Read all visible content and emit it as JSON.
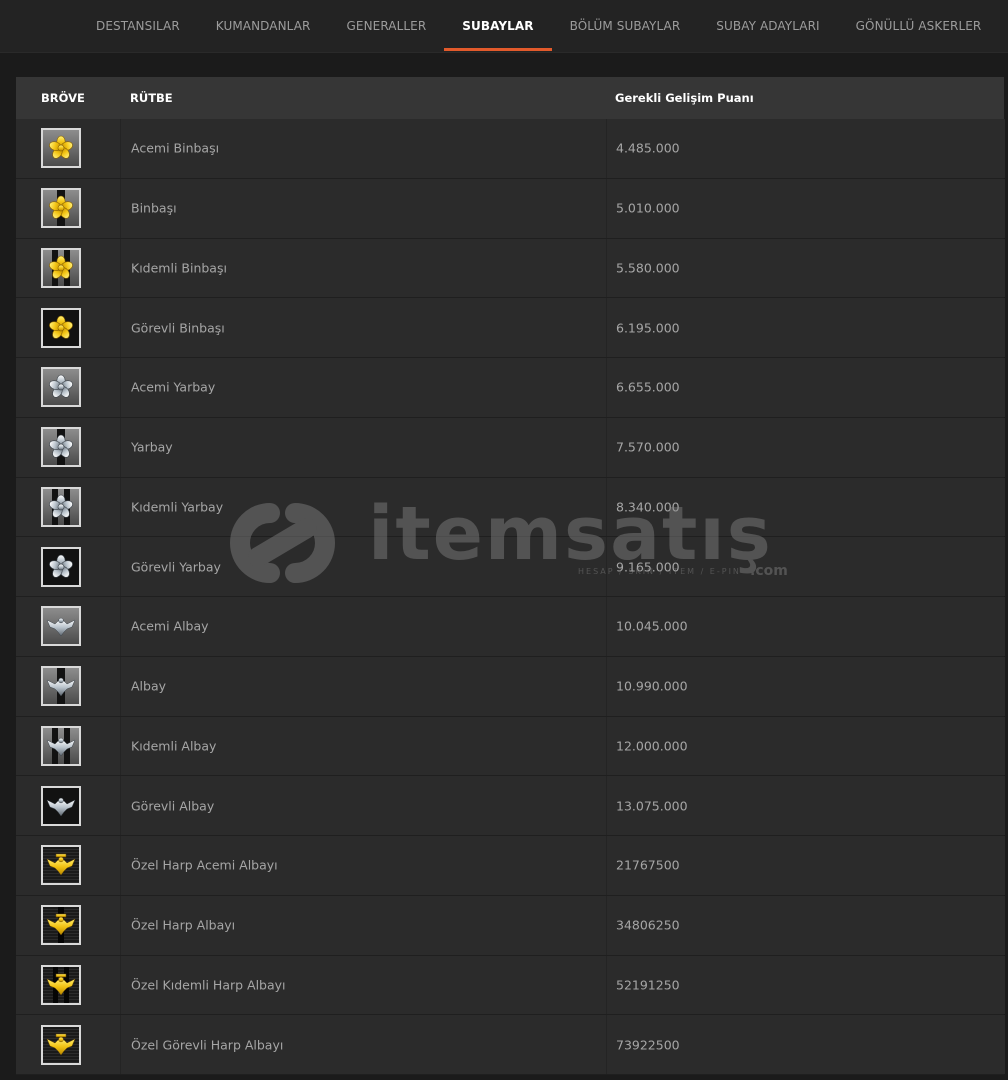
{
  "nav": {
    "tabs": [
      {
        "label": "DESTANSILAR",
        "active": false
      },
      {
        "label": "KUMANDANLAR",
        "active": false
      },
      {
        "label": "GENERALLER",
        "active": false
      },
      {
        "label": "SUBAYLAR",
        "active": true
      },
      {
        "label": "BÖLÜM SUBAYLAR",
        "active": false
      },
      {
        "label": "SUBAY ADAYLARI",
        "active": false
      },
      {
        "label": "GÖNÜLLÜ ASKERLER",
        "active": false
      }
    ],
    "accent_color": "#e25a2b"
  },
  "table": {
    "headers": {
      "badge": "BRÖVE",
      "rank": "RÜTBE",
      "points": "Gerekli Gelişim Puanı"
    },
    "rows": [
      {
        "rank": "Acemi Binbaşı",
        "points": "4.485.000",
        "badge_icon": "gold-leaf-icon",
        "stripes": 0,
        "tone": "gold"
      },
      {
        "rank": "Binbaşı",
        "points": "5.010.000",
        "badge_icon": "gold-leaf-icon",
        "stripes": 1,
        "tone": "gold"
      },
      {
        "rank": "Kıdemli Binbaşı",
        "points": "5.580.000",
        "badge_icon": "gold-leaf-icon",
        "stripes": 2,
        "tone": "gold"
      },
      {
        "rank": "Görevli Binbaşı",
        "points": "6.195.000",
        "badge_icon": "gold-leaf-icon",
        "stripes": 3,
        "tone": "gold"
      },
      {
        "rank": "Acemi Yarbay",
        "points": "6.655.000",
        "badge_icon": "silver-leaf-icon",
        "stripes": 0,
        "tone": "silver"
      },
      {
        "rank": "Yarbay",
        "points": "7.570.000",
        "badge_icon": "silver-leaf-icon",
        "stripes": 1,
        "tone": "silver"
      },
      {
        "rank": "Kıdemli Yarbay",
        "points": "8.340.000",
        "badge_icon": "silver-leaf-icon",
        "stripes": 2,
        "tone": "silver"
      },
      {
        "rank": "Görevli Yarbay",
        "points": "9.165.000",
        "badge_icon": "silver-leaf-icon",
        "stripes": 3,
        "tone": "silver"
      },
      {
        "rank": "Acemi Albay",
        "points": "10.045.000",
        "badge_icon": "silver-eagle-icon",
        "stripes": 0,
        "tone": "silver"
      },
      {
        "rank": "Albay",
        "points": "10.990.000",
        "badge_icon": "silver-eagle-icon",
        "stripes": 1,
        "tone": "silver"
      },
      {
        "rank": "Kıdemli Albay",
        "points": "12.000.000",
        "badge_icon": "silver-eagle-icon",
        "stripes": 2,
        "tone": "silver"
      },
      {
        "rank": "Görevli Albay",
        "points": "13.075.000",
        "badge_icon": "silver-eagle-icon",
        "stripes": 3,
        "tone": "silver"
      },
      {
        "rank": "Özel Harp Acemi Albayı",
        "points": "21767500",
        "badge_icon": "gold-eagle-icon",
        "stripes": 0,
        "tone": "black"
      },
      {
        "rank": "Özel Harp Albayı",
        "points": "34806250",
        "badge_icon": "gold-eagle-icon",
        "stripes": 1,
        "tone": "black"
      },
      {
        "rank": "Özel Kıdemli Harp Albayı",
        "points": "52191250",
        "badge_icon": "gold-eagle-icon",
        "stripes": 2,
        "tone": "black"
      },
      {
        "rank": "Özel Görevli Harp Albayı",
        "points": "73922500",
        "badge_icon": "gold-eagle-icon",
        "stripes": 3,
        "tone": "black"
      }
    ]
  },
  "watermark": {
    "brand": "itemsatış",
    "tagline": "HESAP / SKIN / ITEM / E-PIN",
    "suffix": ".com"
  }
}
